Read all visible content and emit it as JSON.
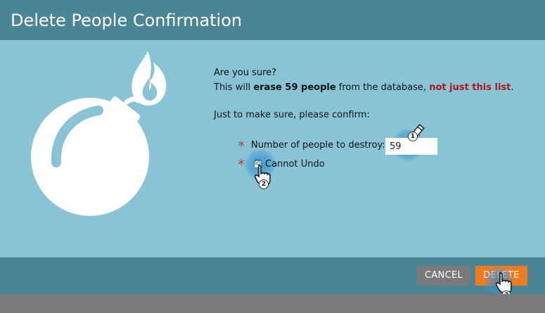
{
  "dialog": {
    "title": "Delete People Confirmation",
    "colors": {
      "header": "#4a8596",
      "body": "#89c4d6",
      "delete_button": "#f07a1e",
      "cancel_button": "#7a7a7a",
      "warning_text": "#b0151b"
    }
  },
  "message": {
    "question": "Are you sure?",
    "line2_prefix": "This will ",
    "line2_bold": "erase 59 people",
    "line2_middle": " from the database,",
    "line2_warning": "not just this list",
    "line2_end": ".",
    "confirm_prompt": "Just to make sure, please confirm:"
  },
  "form": {
    "required_mark": "*",
    "count_label": "Number of people to destroy:",
    "count_value": "59",
    "undo_label": "Cannot Undo",
    "undo_checked": true
  },
  "steps": {
    "one": "1",
    "two": "2",
    "three": "3"
  },
  "buttons": {
    "cancel": "CANCEL",
    "delete": "DELETE"
  },
  "icons": {
    "illustration": "bomb-icon",
    "edit_cursor": "pencil-icon",
    "pointer": "hand-pointer-icon",
    "checkbox_tick": "☑"
  }
}
